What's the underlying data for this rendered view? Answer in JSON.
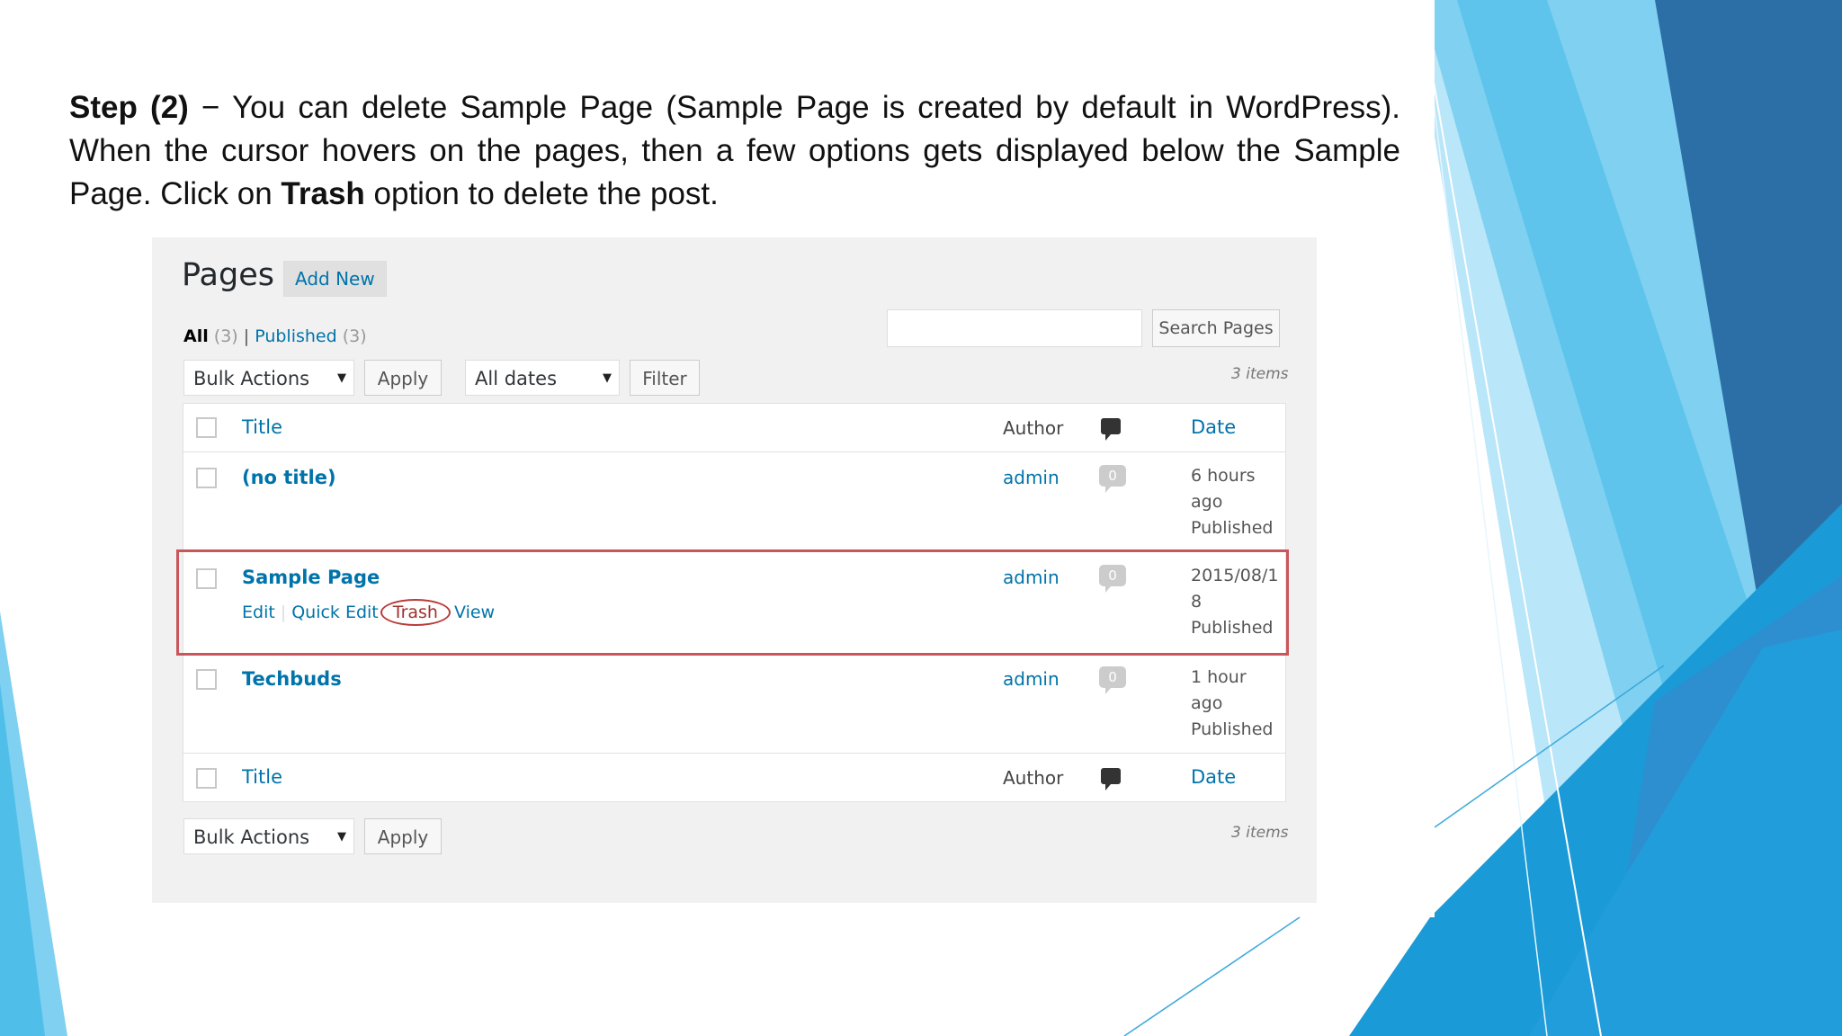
{
  "slide": {
    "step_label": "Step (2)",
    "text_part1": " − You can delete Sample Page (Sample Page is created by default in WordPress). When the cursor hovers on the pages, then a few options gets displayed below the Sample Page. Click on ",
    "trash_bold": "Trash",
    "text_part2": " option to delete the post.",
    "accent_colors": [
      "#1a9ad6",
      "#7fd0f1",
      "#2c6ea6",
      "#b9e6f8"
    ]
  },
  "wp": {
    "title": "Pages",
    "add_new": "Add New",
    "filters": {
      "all_label": "All",
      "all_count": "(3)",
      "separator": "|",
      "published_label": "Published",
      "published_count": "(3)"
    },
    "search_button": "Search Pages",
    "top_bar": {
      "bulk_actions": "Bulk Actions",
      "apply": "Apply",
      "dates": "All dates",
      "filter": "Filter",
      "items": "3 items"
    },
    "table": {
      "header": {
        "title": "Title",
        "author": "Author",
        "date": "Date"
      },
      "rows": [
        {
          "title": "(no title)",
          "author": "admin",
          "comments": "0",
          "date_line1": "6 hours",
          "date_line2": "ago",
          "status": "Published"
        },
        {
          "title": "Sample Page",
          "author": "admin",
          "comments": "0",
          "date_line1": "2015/08/1",
          "date_line2": "8",
          "status": "Published",
          "actions": {
            "edit": "Edit",
            "quick_edit": "Quick Edit",
            "trash": "Trash",
            "view": "View"
          }
        },
        {
          "title": "Techbuds",
          "author": "admin",
          "comments": "0",
          "date_line1": "1 hour",
          "date_line2": "ago",
          "status": "Published"
        }
      ],
      "footer": {
        "title": "Title",
        "author": "Author",
        "date": "Date"
      }
    },
    "bottom_bar": {
      "bulk_actions": "Bulk Actions",
      "apply": "Apply",
      "items": "3 items"
    }
  }
}
